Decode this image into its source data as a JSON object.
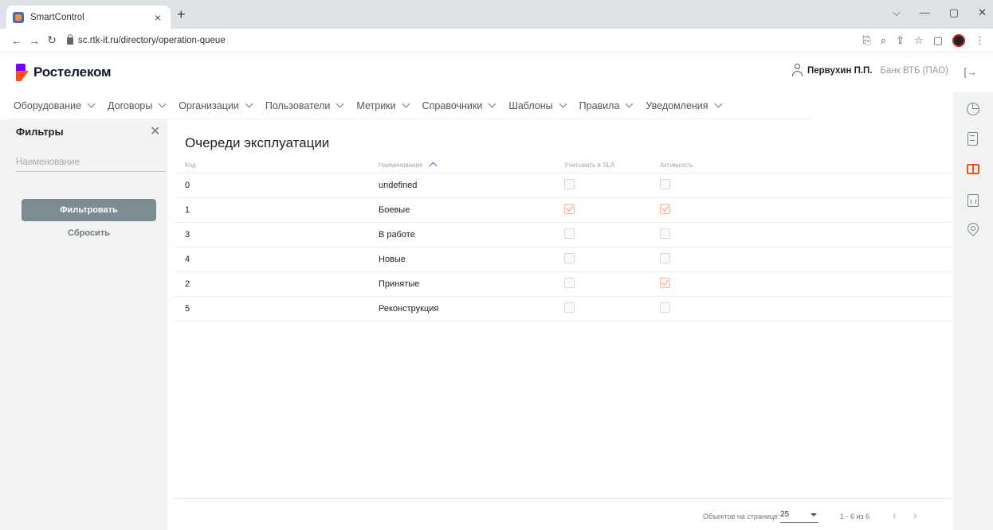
{
  "browser": {
    "tab_title": "SmartControl",
    "tab_close": "×",
    "new_tab": "+",
    "url": "sc.rtk-it.ru/directory/operation-queue",
    "controls": [
      "⌵",
      "—",
      "▢",
      "✕"
    ]
  },
  "header": {
    "logo_text": "Ростелеком",
    "user_name": "Первухин П.П.",
    "user_org": "Банк ВТБ (ПАО)",
    "logout_icon": "logout-icon"
  },
  "menu": {
    "items": [
      {
        "label": "Оборудование"
      },
      {
        "label": "Договоры"
      },
      {
        "label": "Организации"
      },
      {
        "label": "Пользователи"
      },
      {
        "label": "Метрики"
      },
      {
        "label": "Справочники"
      },
      {
        "label": "Шаблоны"
      },
      {
        "label": "Правила"
      },
      {
        "label": "Уведомления"
      }
    ]
  },
  "filters": {
    "title": "Фильтры",
    "close": "✕",
    "name_placeholder": "Наименование",
    "name_value": "",
    "filter_button": "Фильтровать",
    "reset_button": "Сбросить"
  },
  "main": {
    "title": "Очереди эксплуатации",
    "columns": {
      "code": "Код",
      "name": "Наименование",
      "sla": "Учитывать в SLA",
      "active": "Активность"
    },
    "sort": {
      "column": "name",
      "direction": "ascending"
    },
    "rows": [
      {
        "code": "0",
        "name": "undefined",
        "sla": false,
        "active": false
      },
      {
        "code": "1",
        "name": "Боевые",
        "sla": true,
        "active": true
      },
      {
        "code": "3",
        "name": "В работе",
        "sla": false,
        "active": false
      },
      {
        "code": "4",
        "name": "Новые",
        "sla": false,
        "active": false
      },
      {
        "code": "2",
        "name": "Принятые",
        "sla": false,
        "active": true
      },
      {
        "code": "5",
        "name": "Реконструкция",
        "sla": false,
        "active": false
      }
    ]
  },
  "pagination": {
    "per_page_label": "Объектов на странице:",
    "per_page_value": "25",
    "range": "1 - 6 из 6",
    "prev": "‹",
    "next": "›"
  },
  "rail": {
    "icons": [
      "dashboard-icon",
      "document-icon",
      "directory-book-icon",
      "report-icon",
      "location-pin-icon"
    ],
    "active": "directory-book-icon"
  },
  "colors": {
    "brand_orange": "#ff4f12",
    "brand_purple": "#7700ff",
    "filter_button": "#7d8c90",
    "panel_bg": "#f2f3f3"
  }
}
